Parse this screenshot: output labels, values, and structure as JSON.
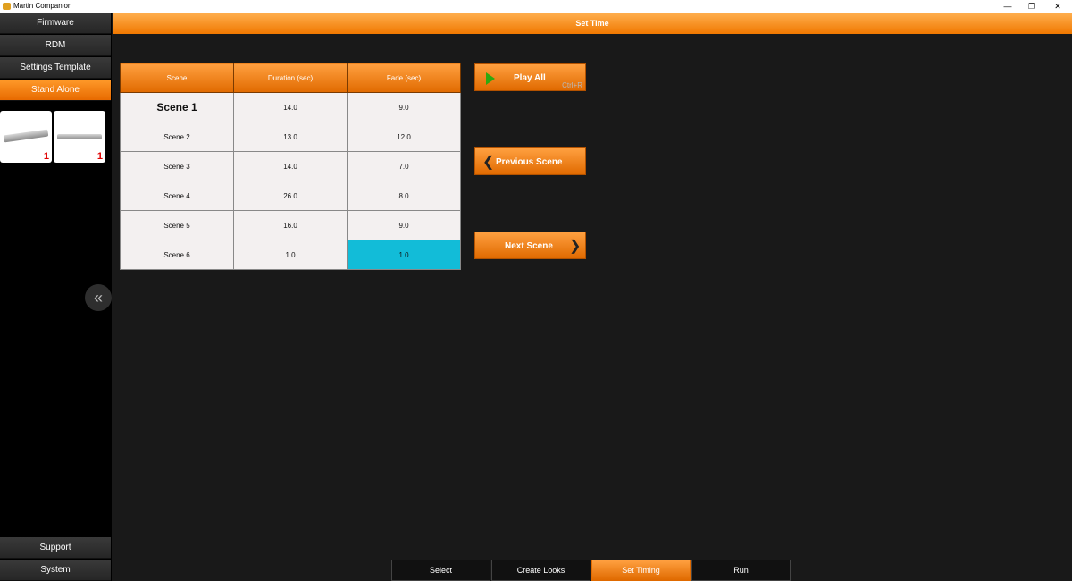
{
  "window": {
    "title": "Martin Companion",
    "minimize_glyph": "—",
    "restore_glyph": "❐",
    "close_glyph": "✕"
  },
  "sidebar": {
    "items": [
      {
        "label": "Firmware"
      },
      {
        "label": "RDM"
      },
      {
        "label": "Settings Template"
      },
      {
        "label": "Stand Alone",
        "active": true
      }
    ],
    "fixtures": [
      {
        "count": "1"
      },
      {
        "count": "1"
      }
    ],
    "collapse_glyph": "«",
    "bottom_items": [
      {
        "label": "Support"
      },
      {
        "label": "System"
      }
    ]
  },
  "header": {
    "title": "Set Time"
  },
  "table": {
    "columns": [
      "Scene",
      "Duration (sec)",
      "Fade (sec)"
    ],
    "rows": [
      {
        "scene": "Scene 1",
        "duration": "14.0",
        "fade": "9.0"
      },
      {
        "scene": "Scene 2",
        "duration": "13.0",
        "fade": "12.0"
      },
      {
        "scene": "Scene 3",
        "duration": "14.0",
        "fade": "7.0"
      },
      {
        "scene": "Scene 4",
        "duration": "26.0",
        "fade": "8.0"
      },
      {
        "scene": "Scene 5",
        "duration": "16.0",
        "fade": "9.0"
      },
      {
        "scene": "Scene 6",
        "duration": "1.0",
        "fade": "1.0"
      }
    ]
  },
  "actions": {
    "play_all": {
      "label": "Play All",
      "shortcut": "Ctrl+R"
    },
    "previous": {
      "label": "Previous Scene",
      "glyph": "❮"
    },
    "next": {
      "label": "Next Scene",
      "glyph": "❯"
    }
  },
  "tabs": [
    {
      "label": "Select"
    },
    {
      "label": "Create Looks"
    },
    {
      "label": "Set Timing",
      "active": true
    },
    {
      "label": "Run"
    }
  ],
  "colors": {
    "accent": "#f07800",
    "selected_cell": "#12bcd8",
    "count_badge": "#e00000",
    "play_icon": "#2ea810"
  }
}
